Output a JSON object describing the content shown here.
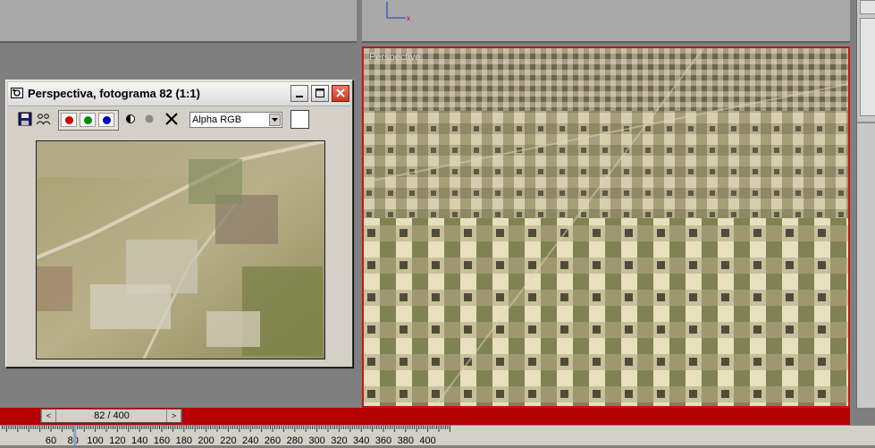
{
  "render_window": {
    "title": "Perspectiva, fotograma 82 (1:1)",
    "channel_dropdown_value": "Alpha RGB"
  },
  "viewport": {
    "label": "Perspective"
  },
  "time_slider": {
    "current_frame": "82 / 400",
    "prev_arrow": "<",
    "next_arrow": ">"
  },
  "ruler": {
    "labels": [
      "60",
      "80",
      "100",
      "120",
      "140",
      "160",
      "180",
      "200",
      "220",
      "240",
      "260",
      "280",
      "300",
      "320",
      "340",
      "360",
      "380",
      "400"
    ]
  },
  "colors": {
    "active_viewport_border": "#c4161c",
    "time_bar": "#b50000",
    "red_channel": "#d40000",
    "green_channel": "#008c00",
    "blue_channel": "#0000c8"
  }
}
